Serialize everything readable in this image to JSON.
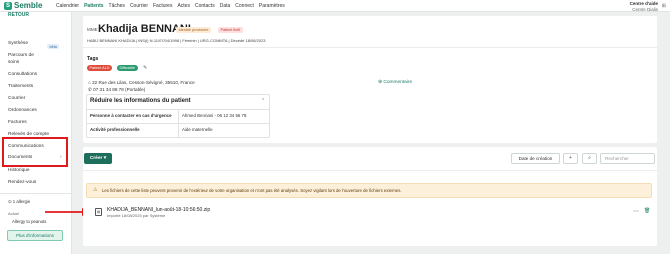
{
  "app": {
    "logo_text": "Semble",
    "logo_mark": "S"
  },
  "nav": [
    "Calendrier",
    "Patients",
    "Tâches",
    "Courrier",
    "Factures",
    "Actes",
    "Contacts",
    "Data",
    "Connect",
    "Paramètres"
  ],
  "help": {
    "title": "Centre d'aide",
    "subtitle": "Centre Dialis"
  },
  "sidebar": {
    "back": "RETOUR",
    "items": [
      "Synthèse",
      "Parcours de soins",
      "Consultations",
      "Traitements",
      "Courrier",
      "Ordonnances",
      "Factures",
      "Relevés de compte",
      "Communications",
      "Documents",
      "Historique",
      "Rendez-vous"
    ],
    "beta": "bêta",
    "allergy_title": "1 allergie",
    "actuel": "Actuel",
    "allergy": "Allergy to peanuts",
    "more_button": "Plus d'informations"
  },
  "patient": {
    "prefix": "MME",
    "name": "Khadija BENNANI",
    "badges": [
      "Identité provisoire",
      "Patient fictif"
    ],
    "meta": "HABIJ BENNANI KHADIJA  |  INS(i) N-11/07/04/1998  |  Féminin  |  URG-CGMMTA  |  Décédé 18/08/2023",
    "tags_label": "Tags",
    "tags": [
      "Patient ALD",
      "Diffusible"
    ],
    "address": "22 Rue des Lilas, Cesson-Sévigné, 35510, France",
    "phone": "07 31 34 88 78 (Portable)",
    "comment": "Commentaire",
    "reduce_title": "Réduire les informations du patient",
    "rows": [
      {
        "label": "Personne à contacter en cas d'urgence",
        "value": "Ahmed Bennani - 06 12 34 56 78"
      },
      {
        "label": "Activité professionnelle",
        "value": "Aide maternelle"
      }
    ]
  },
  "documents": {
    "create": "Créer",
    "sort": "Date de création",
    "search_placeholder": "Rechercher",
    "warning": "Les fichiers de cette liste peuvent provenir de l'extérieur de votre organisation et n'ont pas été analysés. Soyez vigilant lors de l'ouverture de fichiers externes.",
    "file": {
      "name": "KHADIJA_BENNANI_lun-août-18-10:56:50.zip",
      "meta": "Importé 18/08/2025 par Système"
    }
  },
  "colors": {
    "accent": "#1e7d66",
    "highlight": "#e0191c"
  }
}
